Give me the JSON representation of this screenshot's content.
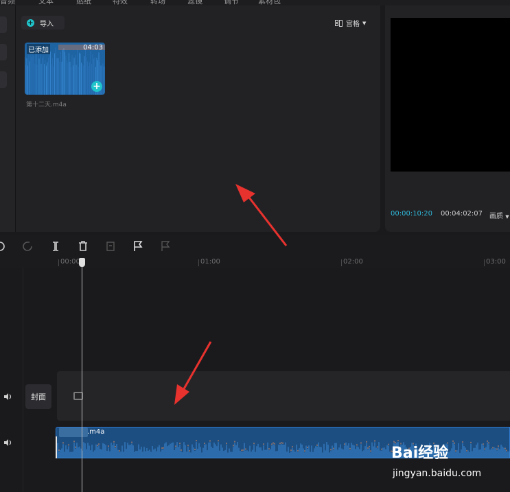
{
  "top_menu": {
    "items": [
      "音频",
      "文本",
      "贴纸",
      "特效",
      "转场",
      "滤镜",
      "调节",
      "素材包"
    ]
  },
  "media_panel": {
    "import_label": "导入",
    "view_mode_label": "宫格",
    "card": {
      "added_label": "已添加",
      "duration": "04:03",
      "filename": "第十二天.m4a"
    }
  },
  "player": {
    "current_time": "00:00:10:20",
    "total_time": "00:04:02:07",
    "quality_label": "画质"
  },
  "timeline": {
    "ruler_labels": [
      "00:00",
      "01:00",
      "02:00",
      "03:00"
    ],
    "cover_label": "封面",
    "audio_clip_name": ".m4a"
  },
  "watermark": {
    "logo": "Bai经验",
    "url": "jingyan.baidu.com"
  },
  "colors": {
    "accent": "#20c4cb",
    "timecode": "#2fb8d8",
    "audio_clip": "#1d4e82",
    "arrow": "#e8322e"
  },
  "icons": {
    "toolbar": [
      "undo-icon",
      "redo-icon",
      "split-icon",
      "delete-icon",
      "freeze-icon",
      "marker-icon",
      "marker-disabled-icon"
    ]
  }
}
